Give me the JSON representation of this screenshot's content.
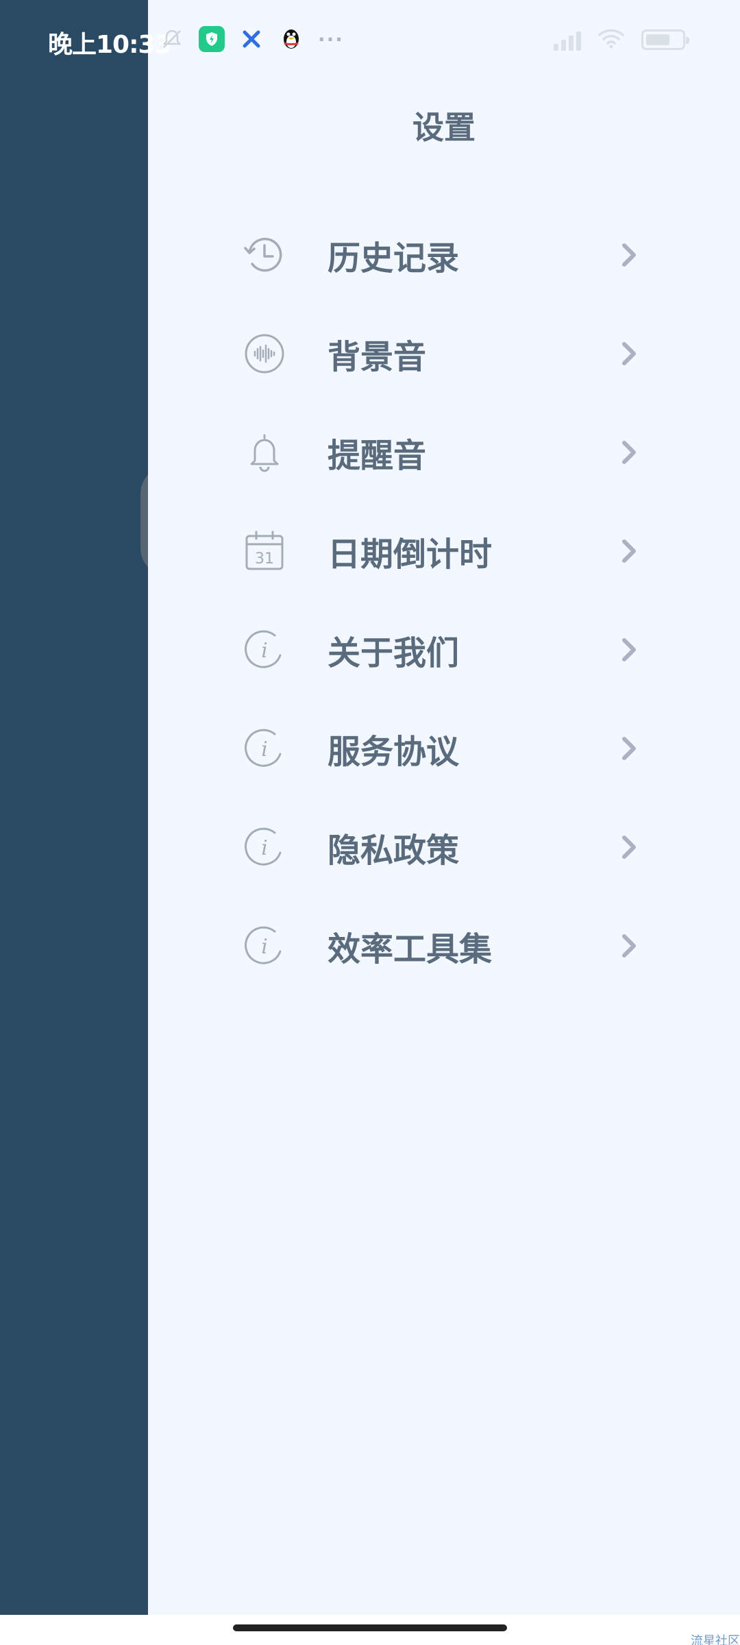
{
  "status_bar": {
    "time": "晚上10:33",
    "left_icons": [
      "mute-icon",
      "shield-app-icon",
      "x-app-icon",
      "qq-penguin-icon",
      "more-dots-icon"
    ],
    "right_icons": [
      "cellular-signal-icon",
      "wifi-icon",
      "battery-icon"
    ]
  },
  "drawer": {
    "title": "设置",
    "items": [
      {
        "label": "历史记录",
        "icon": "history-clock-icon"
      },
      {
        "label": "背景音",
        "icon": "soundwave-icon"
      },
      {
        "label": "提醒音",
        "icon": "bell-icon"
      },
      {
        "label": "日期倒计时",
        "icon": "calendar-icon",
        "icon_text": "31"
      },
      {
        "label": "关于我们",
        "icon": "info-icon",
        "icon_text": "i"
      },
      {
        "label": "服务协议",
        "icon": "info-icon",
        "icon_text": "i"
      },
      {
        "label": "隐私政策",
        "icon": "info-icon",
        "icon_text": "i"
      },
      {
        "label": "效率工具集",
        "icon": "info-icon",
        "icon_text": "i"
      }
    ]
  },
  "colors": {
    "backdrop": "#2a4a64",
    "drawer_bg": "#f2f8fd",
    "text": "#5b6b7e",
    "icon": "#a3acb7",
    "chevron": "#a9b1c3"
  },
  "watermark": "流星社区"
}
